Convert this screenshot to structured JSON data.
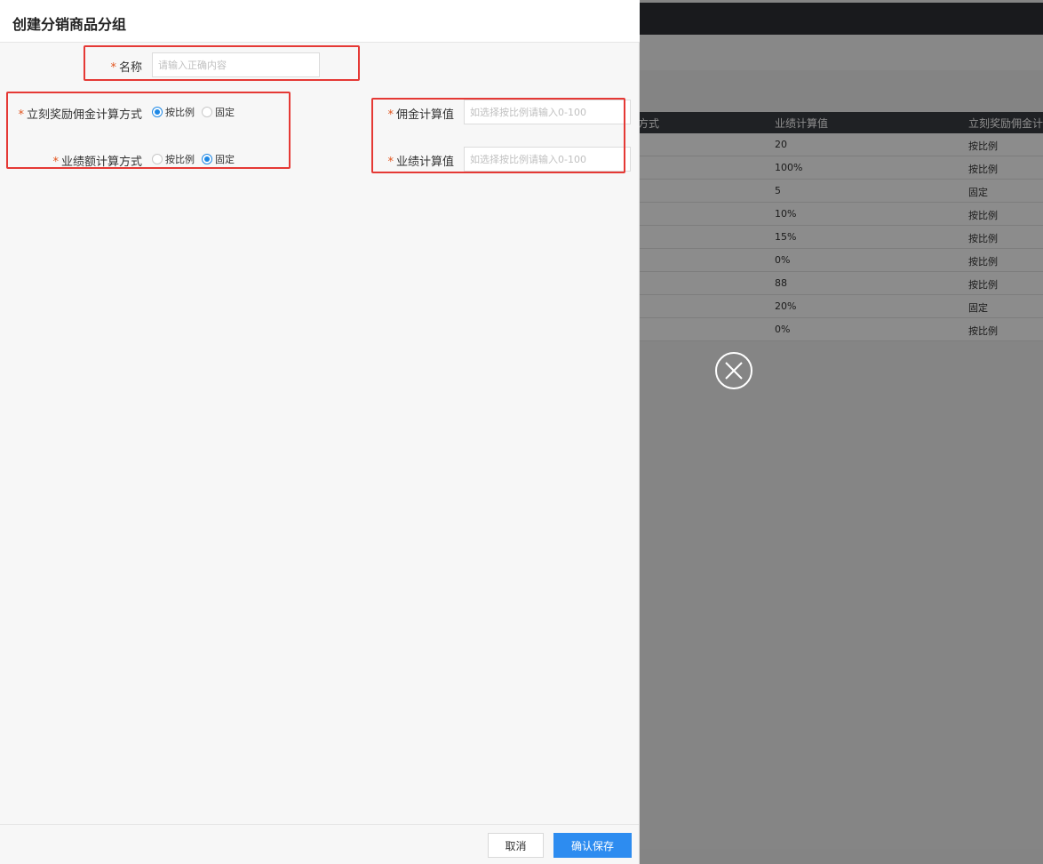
{
  "drawer": {
    "title": "创建分销商品分组",
    "fields": {
      "name": {
        "label": "名称",
        "placeholder": "请输入正确内容",
        "value": ""
      },
      "commission_method": {
        "label": "立刻奖励佣金计算方式",
        "options": [
          "按比例",
          "固定"
        ],
        "selected": "按比例"
      },
      "performance_method": {
        "label": "业绩额计算方式",
        "options": [
          "按比例",
          "固定"
        ],
        "selected": "固定"
      },
      "commission_value": {
        "label": "佣金计算值",
        "placeholder": "如选择按比例请输入0-100",
        "value": ""
      },
      "performance_value": {
        "label": "业绩计算值",
        "placeholder": "如选择按比例请输入0-100",
        "value": ""
      }
    },
    "required_mark": "*",
    "footer": {
      "cancel_label": "取消",
      "save_label": "确认保存"
    }
  },
  "background_table": {
    "headers": [
      "方式",
      "业绩计算值",
      "立刻奖励佣金计"
    ],
    "rows": [
      {
        "performance_value": "20",
        "commission_method": "按比例"
      },
      {
        "performance_value": "100%",
        "commission_method": "按比例"
      },
      {
        "performance_value": "5",
        "commission_method": "固定"
      },
      {
        "performance_value": "10%",
        "commission_method": "按比例"
      },
      {
        "performance_value": "15%",
        "commission_method": "按比例"
      },
      {
        "performance_value": "0%",
        "commission_method": "按比例"
      },
      {
        "performance_value": "88",
        "commission_method": "按比例"
      },
      {
        "performance_value": "20%",
        "commission_method": "固定"
      },
      {
        "performance_value": "0%",
        "commission_method": "按比例"
      }
    ]
  },
  "colors": {
    "accent": "#2d8cf0",
    "required": "#e2551f",
    "annotation": "#e53935"
  },
  "icons": {
    "close": "close-circle-icon"
  }
}
